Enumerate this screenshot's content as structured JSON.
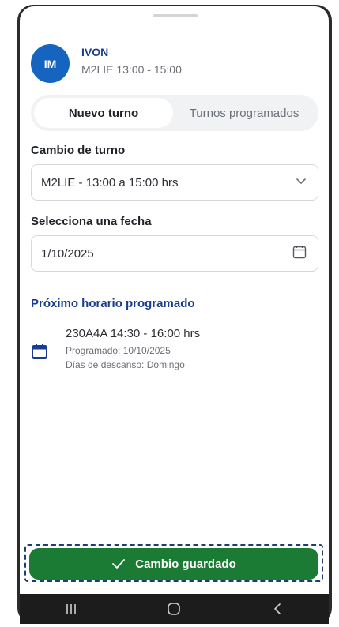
{
  "user": {
    "initials": "IM",
    "name": "IVON",
    "shift": "M2LIE 13:00 - 15:00"
  },
  "tabs": [
    {
      "label": "Nuevo turno",
      "active": true
    },
    {
      "label": "Turnos programados",
      "active": false
    }
  ],
  "shift_change": {
    "label": "Cambio de turno",
    "selected": "M2LIE - 13:00 a 15:00 hrs"
  },
  "date_select": {
    "label": "Selecciona una fecha",
    "value": "1/10/2025"
  },
  "next_schedule": {
    "title": "Próximo horario programado",
    "main": "230A4A 14:30 - 16:00 hrs",
    "programmed": "Programado: 10/10/2025",
    "rest_days": "Días de descanso: Domingo"
  },
  "save_button": {
    "label": "Cambio guardado"
  },
  "colors": {
    "primary_blue": "#1565c0",
    "heading_blue": "#1a3d8f",
    "success_green": "#1b7a33"
  }
}
